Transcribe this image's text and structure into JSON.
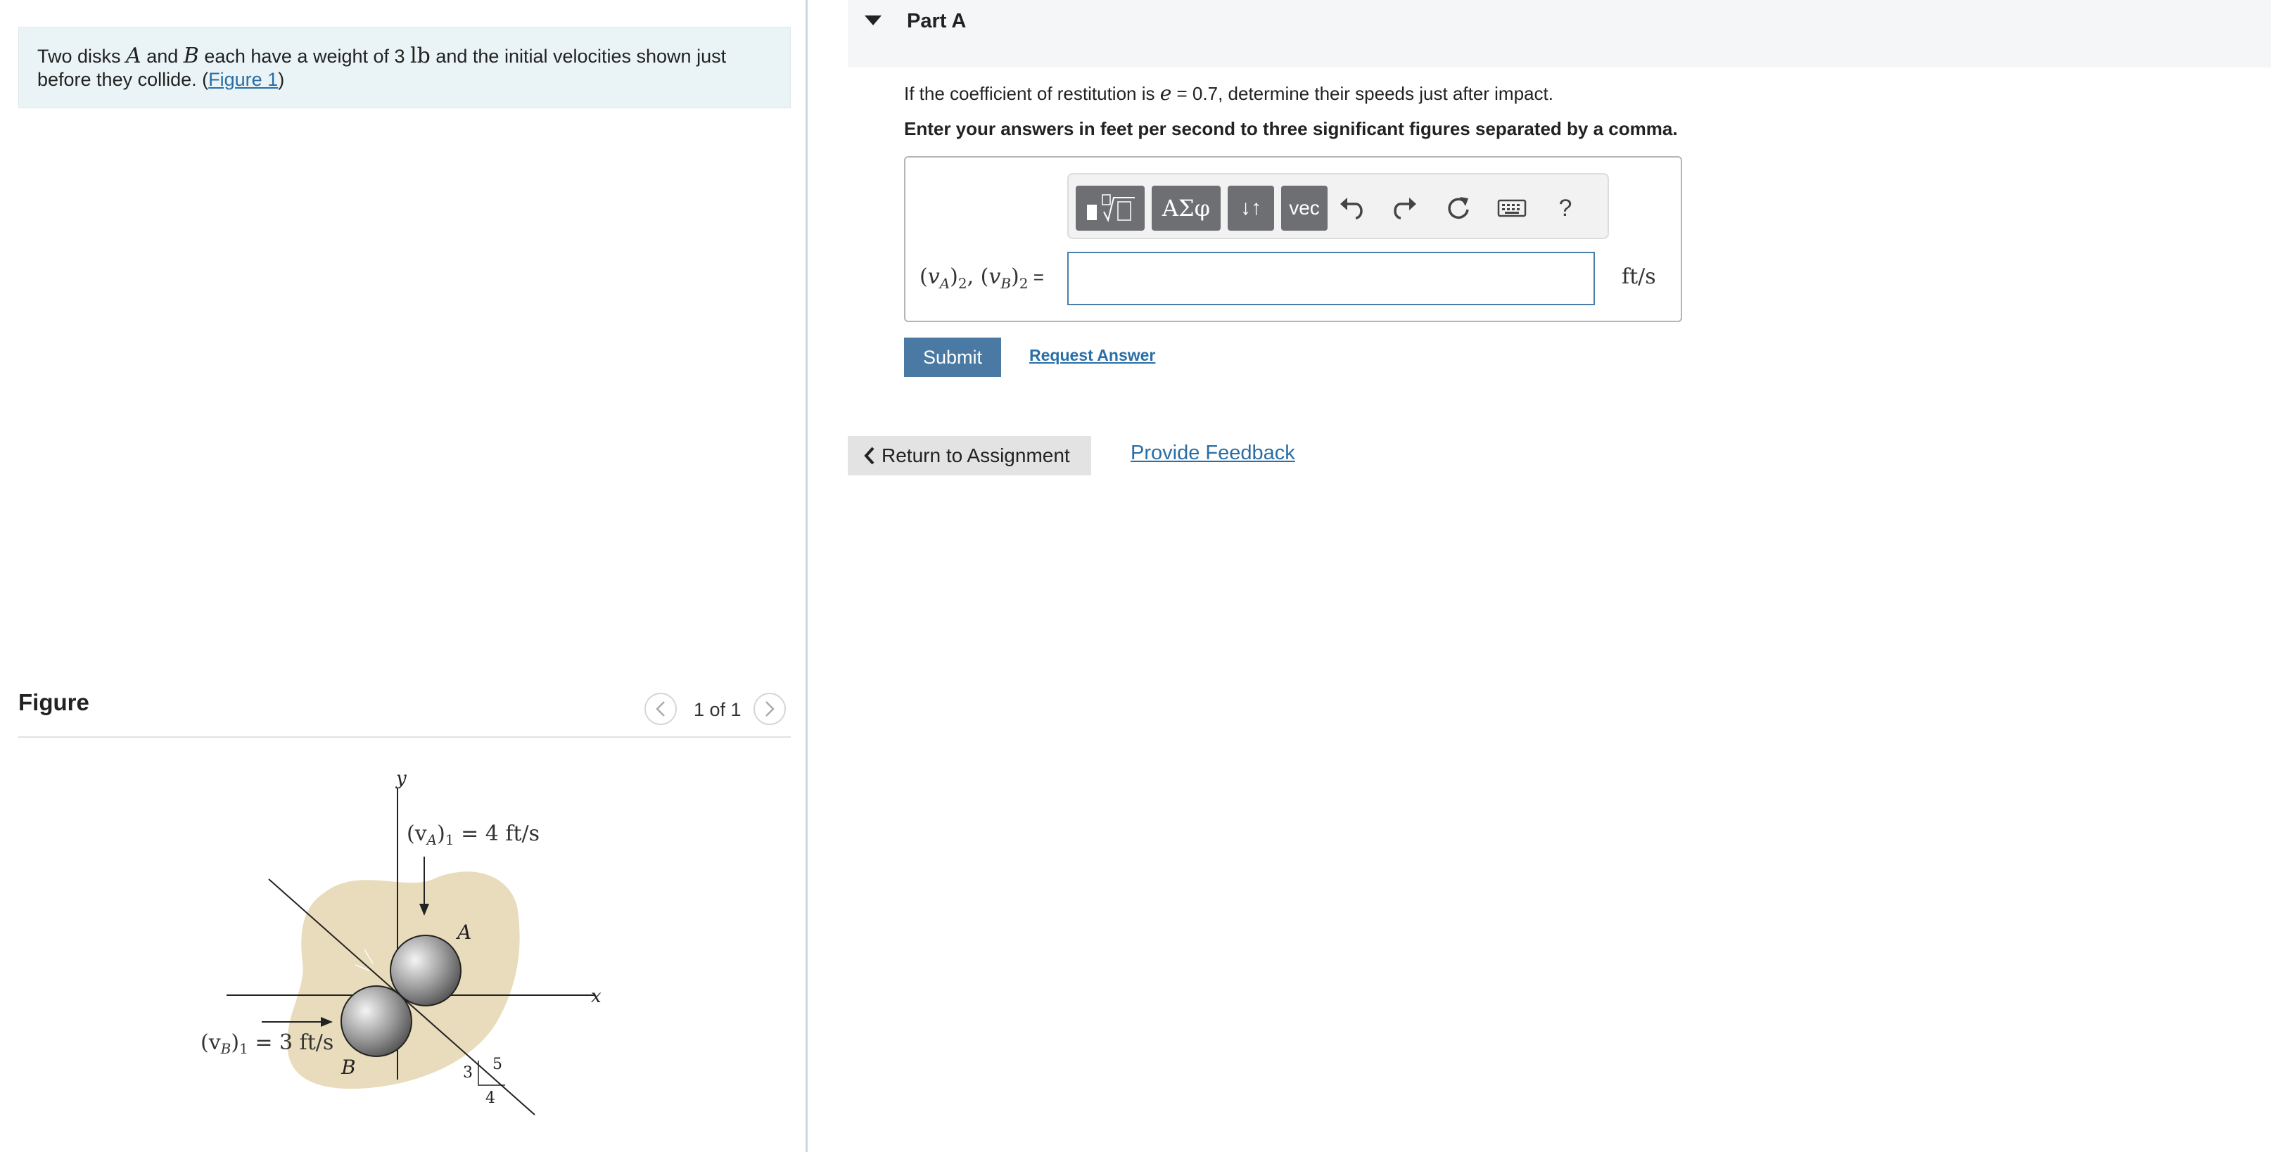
{
  "problem": {
    "text_1": "Two disks ",
    "var_a": "A",
    "text_2": " and ",
    "var_b": "B",
    "text_3": " each have a weight of 3 ",
    "unit_lb": "lb",
    "text_4": " and the initial velocities shown just before they collide. (",
    "figure_link": "Figure 1",
    "text_5": ")"
  },
  "figure": {
    "title": "Figure",
    "counter": "1 of 1",
    "prev_icon": "chevron-left-icon",
    "next_icon": "chevron-right-icon",
    "labels": {
      "y_axis": "y",
      "x_axis": "x",
      "va1_var": "(v",
      "va1_sub": "A",
      "va1_rest": ")",
      "va1_sub2": "1",
      "va1_value": " = 4 ft/s",
      "vb1_var": "(v",
      "vb1_sub": "B",
      "vb1_rest": ")",
      "vb1_sub2": "1",
      "vb1_value": " = 3 ft/s",
      "disk_a": "A",
      "disk_b": "B",
      "slope_3": "3",
      "slope_4": "4",
      "slope_5": "5"
    }
  },
  "part": {
    "title": "Part A",
    "caret_icon": "caret-down-icon",
    "question_1": "If the coefficient of restitution is ",
    "question_var": "e",
    "question_2": " = 0.7, determine their speeds just after impact.",
    "instruction": "Enter your answers in feet per second to three significant figures separated by a comma."
  },
  "toolbar": {
    "templates_label": "▮√▯",
    "greek_label": "ΑΣφ",
    "arrows_label": "↓↑",
    "vec_label": "vec",
    "undo_icon": "undo-icon",
    "redo_icon": "redo-icon",
    "reset_icon": "reset-icon",
    "keyboard_icon": "keyboard-icon",
    "help_label": "?"
  },
  "answer": {
    "label_open_a": "(",
    "label_v_a": "v",
    "label_sub_a": "A",
    "label_close_a": ")",
    "label_sub2_a": "2",
    "label_sep": ", ",
    "label_open_b": "(",
    "label_v_b": "v",
    "label_sub_b": "B",
    "label_close_b": ")",
    "label_sub2_b": "2",
    "label_eq": " =",
    "value": "",
    "placeholder": "",
    "unit": "ft/s"
  },
  "actions": {
    "submit": "Submit",
    "request_answer": "Request Answer",
    "return": "Return to Assignment",
    "return_icon": "chevron-left-icon",
    "feedback": "Provide Feedback"
  },
  "colors": {
    "problem_bg": "#eaf4f6",
    "link": "#2a6ea6",
    "submit_bg": "#4a7aa3",
    "toolbar_button": "#6d6f73",
    "input_border": "#4a7ea8",
    "blob": "#e8dcbc"
  }
}
